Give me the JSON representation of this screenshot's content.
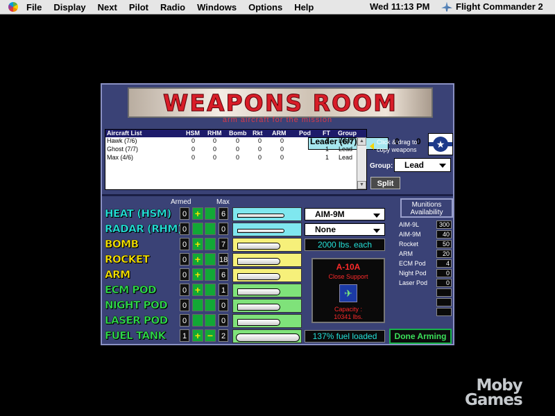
{
  "menubar": {
    "items": [
      "File",
      "Display",
      "Next",
      "Pilot",
      "Radio",
      "Windows",
      "Options",
      "Help"
    ],
    "clock": "Wed 11:13 PM",
    "app_name": "Flight Commander 2"
  },
  "window": {
    "banner_title": "WEAPONS ROOM",
    "subtitle": "arm aircraft for the mission"
  },
  "aircraft_list": {
    "headers": [
      "Aircraft List",
      "HSM",
      "RHM",
      "Bomb",
      "Rkt",
      "ARM",
      "Pod",
      "FT",
      "Group"
    ],
    "rows": [
      {
        "name": "Leader (6/7)",
        "hsm": "0",
        "rhm": "0",
        "bomb": "0",
        "rkt": "0",
        "arm": "0",
        "pod": "",
        "ft": "1",
        "group": "Lead"
      },
      {
        "name": "Hawk (7/6)",
        "hsm": "0",
        "rhm": "0",
        "bomb": "0",
        "rkt": "0",
        "arm": "0",
        "pod": "",
        "ft": "1",
        "group": "Lead"
      },
      {
        "name": "Ghost (7/7)",
        "hsm": "0",
        "rhm": "0",
        "bomb": "0",
        "rkt": "0",
        "arm": "0",
        "pod": "",
        "ft": "1",
        "group": "Lead"
      },
      {
        "name": "Max (4/6)",
        "hsm": "0",
        "rhm": "0",
        "bomb": "0",
        "rkt": "0",
        "arm": "0",
        "pod": "",
        "ft": "1",
        "group": "Lead"
      }
    ],
    "selected_row": 0
  },
  "hint": "Click & drag to copy weapons",
  "group": {
    "label": "Group:",
    "value": "Lead"
  },
  "split_label": "Split",
  "weapons": {
    "armed_header": "Armed",
    "max_header": "Max",
    "rows": [
      {
        "label": "HEAT (HSM)",
        "armed": "0",
        "max": "6",
        "color": "#23e0d8",
        "has_plus": true,
        "has_minus": false
      },
      {
        "label": "RADAR (RHM)",
        "armed": "0",
        "max": "0",
        "color": "#23e0d8",
        "has_plus": false,
        "has_minus": false
      },
      {
        "label": "BOMB",
        "armed": "0",
        "max": "7",
        "color": "#f5e100",
        "has_plus": true,
        "has_minus": false
      },
      {
        "label": "ROCKET",
        "armed": "0",
        "max": "18",
        "color": "#f5e100",
        "has_plus": true,
        "has_minus": false
      },
      {
        "label": "ARM",
        "armed": "0",
        "max": "6",
        "color": "#f5e100",
        "has_plus": true,
        "has_minus": false
      },
      {
        "label": "ECM POD",
        "armed": "0",
        "max": "1",
        "color": "#2fd84a",
        "has_plus": true,
        "has_minus": false
      },
      {
        "label": "NIGHT POD",
        "armed": "0",
        "max": "0",
        "color": "#2fd84a",
        "has_plus": false,
        "has_minus": false
      },
      {
        "label": "LASER POD",
        "armed": "0",
        "max": "0",
        "color": "#2fd84a",
        "has_plus": false,
        "has_minus": false
      },
      {
        "label": "FUEL TANK",
        "armed": "1",
        "max": "2",
        "color": "#2fd84a",
        "has_plus": true,
        "has_minus": true
      }
    ],
    "plus_glyph": "+",
    "minus_glyph": "−"
  },
  "heat_select": "AIM-9M",
  "radar_select": "None",
  "bomb_info": "2000 lbs. each",
  "aircraft": {
    "type": "A-10A",
    "role": "Close Support",
    "capacity_label": "Capacity :",
    "capacity_value": "10341 lbs."
  },
  "fuel_status": "137% fuel loaded",
  "done_label": "Done Arming",
  "munitions": {
    "header": "Munitions Availability",
    "items": [
      {
        "label": "AIM-9L",
        "value": "300"
      },
      {
        "label": "AIM-9M",
        "value": "40"
      },
      {
        "label": "Rocket",
        "value": "50"
      },
      {
        "label": "ARM",
        "value": "20"
      },
      {
        "label": "ECM Pod",
        "value": "4"
      },
      {
        "label": "Night Pod",
        "value": "0"
      },
      {
        "label": "Laser Pod",
        "value": "0"
      },
      {
        "label": "",
        "value": ""
      },
      {
        "label": "",
        "value": ""
      },
      {
        "label": "",
        "value": ""
      }
    ]
  },
  "watermark": {
    "line1": "Moby",
    "line2": "Games"
  }
}
